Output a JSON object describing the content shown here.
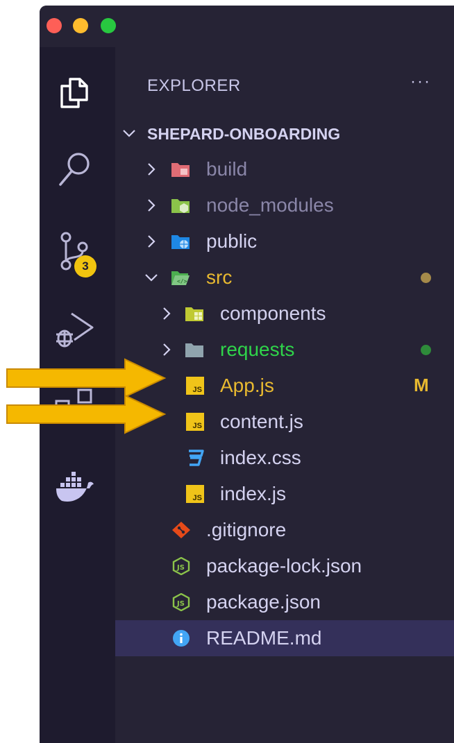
{
  "explorer": {
    "title": "EXPLORER",
    "more": "···"
  },
  "activity_bar": {
    "source_control_badge": "3"
  },
  "project": {
    "name": "SHEPARD-ONBOARDING"
  },
  "tree": [
    {
      "label": "build",
      "kind": "folder",
      "icon": "build-folder-icon"
    },
    {
      "label": "node_modules",
      "kind": "folder",
      "icon": "node-folder-icon"
    },
    {
      "label": "public",
      "kind": "folder",
      "icon": "public-folder-icon"
    },
    {
      "label": "src",
      "kind": "folder-open",
      "icon": "src-folder-icon"
    },
    {
      "label": "components",
      "kind": "folder",
      "icon": "components-folder-icon"
    },
    {
      "label": "requests",
      "kind": "folder",
      "icon": "folder-icon"
    },
    {
      "label": "App.js",
      "kind": "file",
      "icon": "js-file-icon",
      "status": "M"
    },
    {
      "label": "content.js",
      "kind": "file",
      "icon": "js-file-icon"
    },
    {
      "label": "index.css",
      "kind": "file",
      "icon": "css-file-icon"
    },
    {
      "label": "index.js",
      "kind": "file",
      "icon": "js-file-icon"
    },
    {
      "label": ".gitignore",
      "kind": "file",
      "icon": "git-file-icon"
    },
    {
      "label": "package-lock.json",
      "kind": "file",
      "icon": "nodejs-file-icon"
    },
    {
      "label": "package.json",
      "kind": "file",
      "icon": "nodejs-file-icon"
    },
    {
      "label": "README.md",
      "kind": "file",
      "icon": "info-file-icon"
    }
  ],
  "colors": {
    "background": "#262335",
    "activity_bar": "#1e1b2e",
    "modified": "#e8b930",
    "added": "#2fd44a",
    "ignored": "#8a86a8",
    "arrow": "#f5b800"
  }
}
